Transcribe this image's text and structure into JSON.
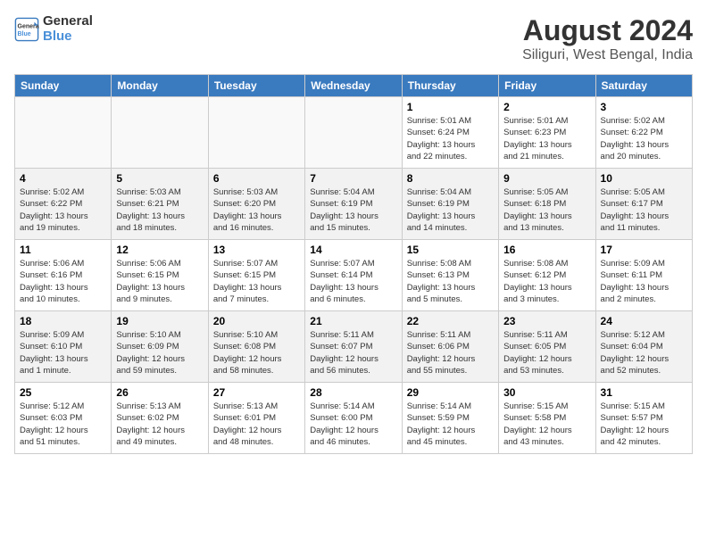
{
  "header": {
    "logo_line1": "General",
    "logo_line2": "Blue",
    "title": "August 2024",
    "subtitle": "Siliguri, West Bengal, India"
  },
  "days_of_week": [
    "Sunday",
    "Monday",
    "Tuesday",
    "Wednesday",
    "Thursday",
    "Friday",
    "Saturday"
  ],
  "weeks": [
    [
      {
        "day": "",
        "info": ""
      },
      {
        "day": "",
        "info": ""
      },
      {
        "day": "",
        "info": ""
      },
      {
        "day": "",
        "info": ""
      },
      {
        "day": "1",
        "info": "Sunrise: 5:01 AM\nSunset: 6:24 PM\nDaylight: 13 hours\nand 22 minutes."
      },
      {
        "day": "2",
        "info": "Sunrise: 5:01 AM\nSunset: 6:23 PM\nDaylight: 13 hours\nand 21 minutes."
      },
      {
        "day": "3",
        "info": "Sunrise: 5:02 AM\nSunset: 6:22 PM\nDaylight: 13 hours\nand 20 minutes."
      }
    ],
    [
      {
        "day": "4",
        "info": "Sunrise: 5:02 AM\nSunset: 6:22 PM\nDaylight: 13 hours\nand 19 minutes."
      },
      {
        "day": "5",
        "info": "Sunrise: 5:03 AM\nSunset: 6:21 PM\nDaylight: 13 hours\nand 18 minutes."
      },
      {
        "day": "6",
        "info": "Sunrise: 5:03 AM\nSunset: 6:20 PM\nDaylight: 13 hours\nand 16 minutes."
      },
      {
        "day": "7",
        "info": "Sunrise: 5:04 AM\nSunset: 6:19 PM\nDaylight: 13 hours\nand 15 minutes."
      },
      {
        "day": "8",
        "info": "Sunrise: 5:04 AM\nSunset: 6:19 PM\nDaylight: 13 hours\nand 14 minutes."
      },
      {
        "day": "9",
        "info": "Sunrise: 5:05 AM\nSunset: 6:18 PM\nDaylight: 13 hours\nand 13 minutes."
      },
      {
        "day": "10",
        "info": "Sunrise: 5:05 AM\nSunset: 6:17 PM\nDaylight: 13 hours\nand 11 minutes."
      }
    ],
    [
      {
        "day": "11",
        "info": "Sunrise: 5:06 AM\nSunset: 6:16 PM\nDaylight: 13 hours\nand 10 minutes."
      },
      {
        "day": "12",
        "info": "Sunrise: 5:06 AM\nSunset: 6:15 PM\nDaylight: 13 hours\nand 9 minutes."
      },
      {
        "day": "13",
        "info": "Sunrise: 5:07 AM\nSunset: 6:15 PM\nDaylight: 13 hours\nand 7 minutes."
      },
      {
        "day": "14",
        "info": "Sunrise: 5:07 AM\nSunset: 6:14 PM\nDaylight: 13 hours\nand 6 minutes."
      },
      {
        "day": "15",
        "info": "Sunrise: 5:08 AM\nSunset: 6:13 PM\nDaylight: 13 hours\nand 5 minutes."
      },
      {
        "day": "16",
        "info": "Sunrise: 5:08 AM\nSunset: 6:12 PM\nDaylight: 13 hours\nand 3 minutes."
      },
      {
        "day": "17",
        "info": "Sunrise: 5:09 AM\nSunset: 6:11 PM\nDaylight: 13 hours\nand 2 minutes."
      }
    ],
    [
      {
        "day": "18",
        "info": "Sunrise: 5:09 AM\nSunset: 6:10 PM\nDaylight: 13 hours\nand 1 minute."
      },
      {
        "day": "19",
        "info": "Sunrise: 5:10 AM\nSunset: 6:09 PM\nDaylight: 12 hours\nand 59 minutes."
      },
      {
        "day": "20",
        "info": "Sunrise: 5:10 AM\nSunset: 6:08 PM\nDaylight: 12 hours\nand 58 minutes."
      },
      {
        "day": "21",
        "info": "Sunrise: 5:11 AM\nSunset: 6:07 PM\nDaylight: 12 hours\nand 56 minutes."
      },
      {
        "day": "22",
        "info": "Sunrise: 5:11 AM\nSunset: 6:06 PM\nDaylight: 12 hours\nand 55 minutes."
      },
      {
        "day": "23",
        "info": "Sunrise: 5:11 AM\nSunset: 6:05 PM\nDaylight: 12 hours\nand 53 minutes."
      },
      {
        "day": "24",
        "info": "Sunrise: 5:12 AM\nSunset: 6:04 PM\nDaylight: 12 hours\nand 52 minutes."
      }
    ],
    [
      {
        "day": "25",
        "info": "Sunrise: 5:12 AM\nSunset: 6:03 PM\nDaylight: 12 hours\nand 51 minutes."
      },
      {
        "day": "26",
        "info": "Sunrise: 5:13 AM\nSunset: 6:02 PM\nDaylight: 12 hours\nand 49 minutes."
      },
      {
        "day": "27",
        "info": "Sunrise: 5:13 AM\nSunset: 6:01 PM\nDaylight: 12 hours\nand 48 minutes."
      },
      {
        "day": "28",
        "info": "Sunrise: 5:14 AM\nSunset: 6:00 PM\nDaylight: 12 hours\nand 46 minutes."
      },
      {
        "day": "29",
        "info": "Sunrise: 5:14 AM\nSunset: 5:59 PM\nDaylight: 12 hours\nand 45 minutes."
      },
      {
        "day": "30",
        "info": "Sunrise: 5:15 AM\nSunset: 5:58 PM\nDaylight: 12 hours\nand 43 minutes."
      },
      {
        "day": "31",
        "info": "Sunrise: 5:15 AM\nSunset: 5:57 PM\nDaylight: 12 hours\nand 42 minutes."
      }
    ]
  ]
}
